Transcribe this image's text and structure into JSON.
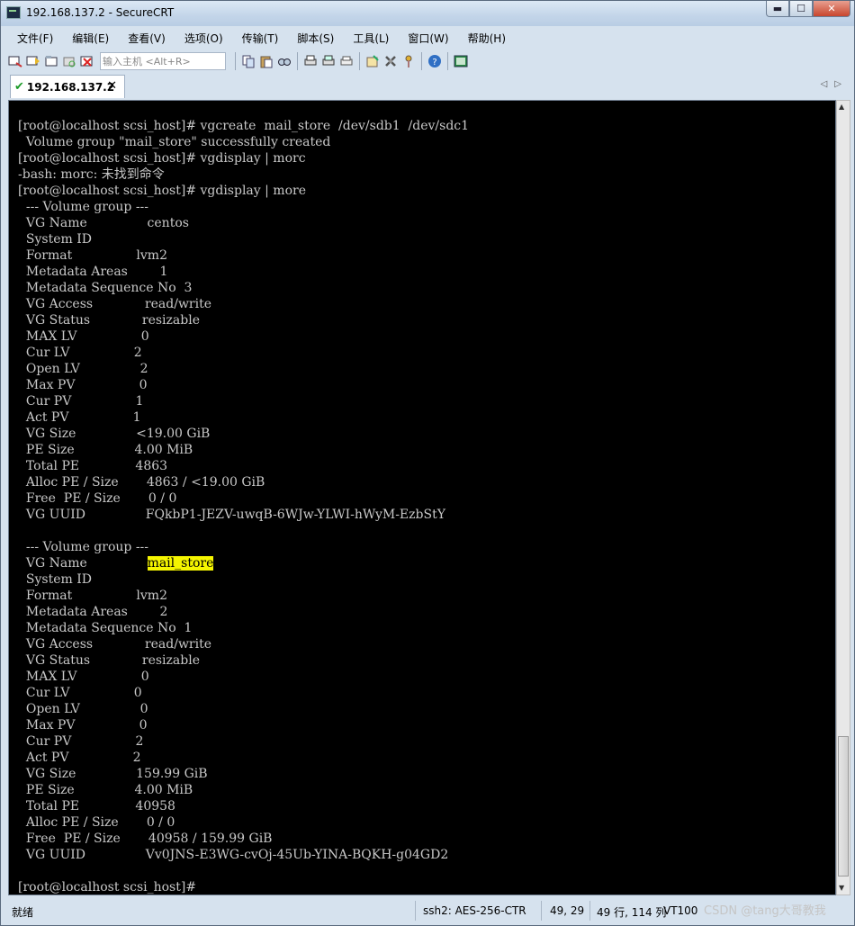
{
  "window": {
    "title": "192.168.137.2 - SecureCRT",
    "min_label": "▬",
    "max_label": "☐",
    "close_label": "✕"
  },
  "menu": [
    "文件(F)",
    "编辑(E)",
    "查看(V)",
    "选项(O)",
    "传输(T)",
    "脚本(S)",
    "工具(L)",
    "窗口(W)",
    "帮助(H)"
  ],
  "toolbar": {
    "host_placeholder": "输入主机 <Alt+R>"
  },
  "tab": {
    "label": "192.168.137.2",
    "close": "✕",
    "nav": "◁▷"
  },
  "terminal": {
    "lines": [
      {
        "text": "[root@localhost scsi_host]# vgcreate  mail_store  /dev/sdb1  /dev/sdc1"
      },
      {
        "text": "  Volume group \"mail_store\" successfully created"
      },
      {
        "text": "[root@localhost scsi_host]# vgdisplay | morc"
      },
      {
        "text": "-bash: morc: 未找到命令"
      },
      {
        "text": "[root@localhost scsi_host]# vgdisplay | more"
      },
      {
        "text": "  --- Volume group ---"
      },
      {
        "text": "  VG Name               centos"
      },
      {
        "text": "  System ID"
      },
      {
        "text": "  Format                lvm2"
      },
      {
        "text": "  Metadata Areas        1"
      },
      {
        "text": "  Metadata Sequence No  3"
      },
      {
        "text": "  VG Access             read/write"
      },
      {
        "text": "  VG Status             resizable"
      },
      {
        "text": "  MAX LV                0"
      },
      {
        "text": "  Cur LV                2"
      },
      {
        "text": "  Open LV               2"
      },
      {
        "text": "  Max PV                0"
      },
      {
        "text": "  Cur PV                1"
      },
      {
        "text": "  Act PV                1"
      },
      {
        "text": "  VG Size               <19.00 GiB"
      },
      {
        "text": "  PE Size               4.00 MiB"
      },
      {
        "text": "  Total PE              4863"
      },
      {
        "text": "  Alloc PE / Size       4863 / <19.00 GiB"
      },
      {
        "text": "  Free  PE / Size       0 / 0"
      },
      {
        "text": "  VG UUID               FQkbP1-JEZV-uwqB-6WJw-YLWI-hWyM-EzbStY"
      },
      {
        "text": ""
      },
      {
        "text": "  --- Volume group ---"
      },
      {
        "text": "  VG Name               ",
        "highlight": "mail_store"
      },
      {
        "text": "  System ID"
      },
      {
        "text": "  Format                lvm2"
      },
      {
        "text": "  Metadata Areas        2"
      },
      {
        "text": "  Metadata Sequence No  1"
      },
      {
        "text": "  VG Access             read/write"
      },
      {
        "text": "  VG Status             resizable"
      },
      {
        "text": "  MAX LV                0"
      },
      {
        "text": "  Cur LV                0"
      },
      {
        "text": "  Open LV               0"
      },
      {
        "text": "  Max PV                0"
      },
      {
        "text": "  Cur PV                2"
      },
      {
        "text": "  Act PV                2"
      },
      {
        "text": "  VG Size               159.99 GiB"
      },
      {
        "text": "  PE Size               4.00 MiB"
      },
      {
        "text": "  Total PE              40958"
      },
      {
        "text": "  Alloc PE / Size       0 / 0"
      },
      {
        "text": "  Free  PE / Size       40958 / 159.99 GiB"
      },
      {
        "text": "  VG UUID               Vv0JNS-E3WG-cvOj-45Ub-YINA-BQKH-g04GD2"
      },
      {
        "text": ""
      },
      {
        "text": "[root@localhost scsi_host]#"
      }
    ]
  },
  "statusbar": {
    "ready": "就绪",
    "cipher": "ssh2: AES-256-CTR",
    "cursor": "49,  29",
    "size": "49 行, 114 列",
    "emulation": "VT100",
    "watermark": "CSDN @tang大哥教我"
  },
  "icons": [
    "connect-icon",
    "quick-connect-icon",
    "connect-tab-icon",
    "reconnect-icon",
    "disconnect-icon",
    "copy-icon",
    "paste-icon",
    "find-icon",
    "print-icon",
    "print-selection-icon",
    "print-setup-icon",
    "session-options-icon",
    "global-options-icon",
    "keymap-icon",
    "help-icon",
    "sftp-icon"
  ]
}
